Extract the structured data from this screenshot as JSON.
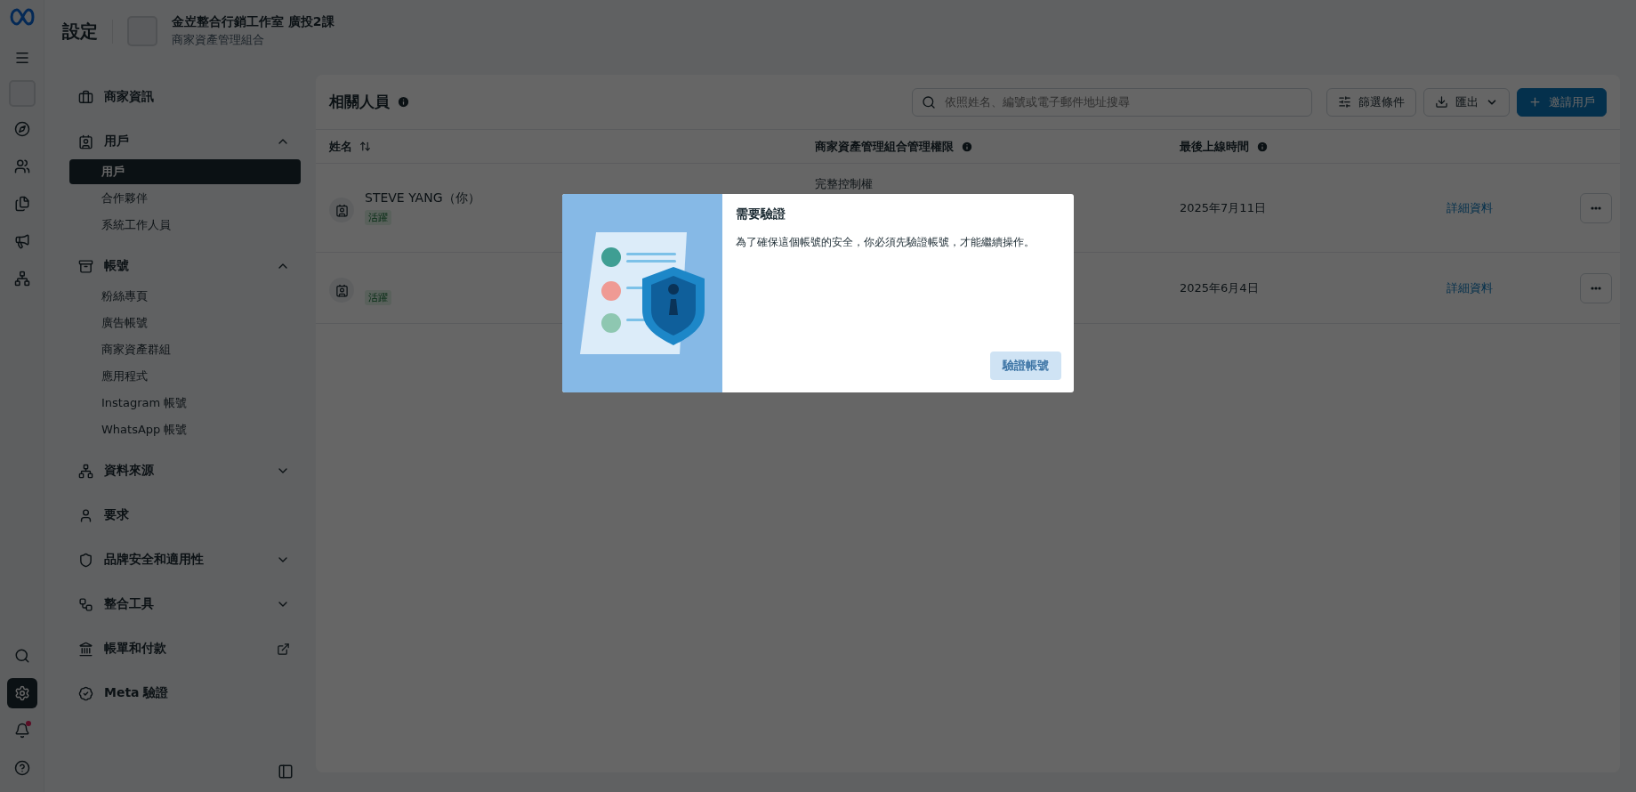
{
  "rail": {
    "bottom": [
      {
        "kind": "search",
        "selected": false
      },
      {
        "kind": "settings",
        "selected": true
      },
      {
        "kind": "notifications",
        "selected": false
      },
      {
        "kind": "help",
        "selected": false
      }
    ]
  },
  "header": {
    "title": "設定",
    "business_name": "金岦整合行銷工作室 廣投2課",
    "business_type": "商家資產管理組合"
  },
  "sidebar": [
    {
      "kind": "link",
      "label": "商家資訊"
    },
    {
      "kind": "group",
      "label": "用戶",
      "expanded": true,
      "children": [
        {
          "label": "用戶",
          "selected": true
        },
        {
          "label": "合作夥伴",
          "selected": false
        },
        {
          "label": "系統工作人員",
          "selected": false
        }
      ]
    },
    {
      "kind": "group",
      "label": "帳號",
      "expanded": true,
      "children": [
        {
          "label": "粉絲專頁",
          "selected": false
        },
        {
          "label": "廣告帳號",
          "selected": false
        },
        {
          "label": "商家資產群組",
          "selected": false
        },
        {
          "label": "應用程式",
          "selected": false
        },
        {
          "label": "Instagram 帳號",
          "selected": false
        },
        {
          "label": "WhatsApp 帳號",
          "selected": false
        }
      ]
    },
    {
      "kind": "group",
      "label": "資料來源",
      "expanded": false
    },
    {
      "kind": "link",
      "label": "要求"
    },
    {
      "kind": "group",
      "label": "品牌安全和適用性",
      "expanded": false
    },
    {
      "kind": "group",
      "label": "整合工具",
      "expanded": false
    },
    {
      "kind": "external",
      "label": "帳單和付款"
    },
    {
      "kind": "link",
      "label": "Meta 驗證"
    }
  ],
  "main": {
    "title": "相關人員",
    "search": {
      "placeholder": "依照姓名、編號或電子郵件地址搜尋"
    },
    "buttons": [
      {
        "kind": "filter",
        "label": "篩選條件"
      },
      {
        "kind": "export",
        "label": "匯出"
      },
      {
        "kind": "invite",
        "label": "邀請用戶"
      }
    ],
    "table": {
      "columns": [
        {
          "kind": "sortable",
          "label": "姓名"
        },
        {
          "kind": "info",
          "label": "商家資產管理組合管理權限"
        },
        {
          "kind": "info",
          "label": "最後上線時間"
        }
      ],
      "rows": [
        {
          "name": "STEVE YANG（你）",
          "status": "活躍",
          "permission": "完整控制權",
          "last_online": "2025年7月11日",
          "link": "詳細資料"
        },
        {
          "status": "活躍",
          "last_online": "2025年6月4日",
          "link": "詳細資料"
        }
      ]
    }
  },
  "dialog": {
    "title": "需要驗證",
    "body": "為了確保這個帳號的安全，你必須先驗證帳號，才能繼續操作。",
    "button": {
      "label": "驗證帳號",
      "disabled": true
    }
  }
}
